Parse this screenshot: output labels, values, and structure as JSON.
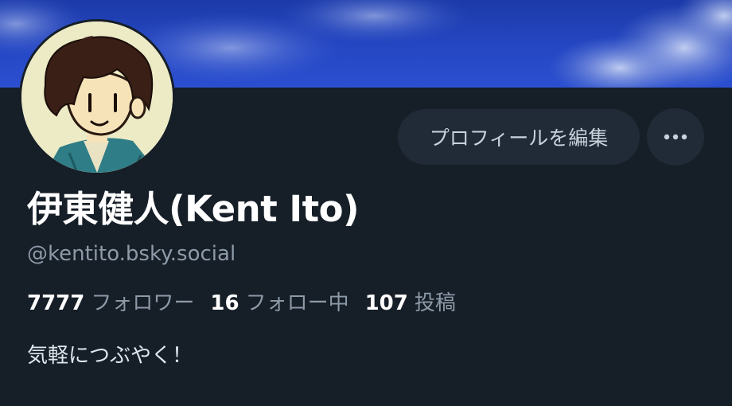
{
  "banner": {
    "image": "blue-sky-clouds"
  },
  "avatar": {
    "image": "illustrated-man-avatar"
  },
  "actions": {
    "edit_profile_label": "プロフィールを編集",
    "more_icon": "more-horizontal-icon"
  },
  "profile": {
    "display_name": "伊東健人(Kent Ito)",
    "handle": "@kentito.bsky.social",
    "bio": "気軽につぶやく！"
  },
  "stats": {
    "followers": {
      "count": "7777",
      "label": "フォロワー"
    },
    "following": {
      "count": "16",
      "label": "フォロー中"
    },
    "posts": {
      "count": "107",
      "label": "投稿"
    }
  },
  "colors": {
    "background": "#161e27",
    "button_bg": "#212b37",
    "secondary_text": "#8d9aa8",
    "banner_blue": "#2547c4"
  }
}
